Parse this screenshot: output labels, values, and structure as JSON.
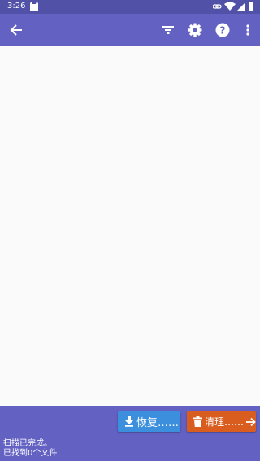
{
  "status_bar": {
    "time": "3:26"
  },
  "toolbar": {
    "back_icon": "arrow-left-icon",
    "filter_icon": "filter-icon",
    "settings_icon": "gear-icon",
    "help_icon": "help-icon",
    "more_icon": "more-vert-icon"
  },
  "actions": {
    "recover_label": "恢复……",
    "clean_label": "清理……"
  },
  "status": {
    "line1": "扫描已完成。",
    "line2": "已找到0个文件"
  },
  "colors": {
    "status_bar": "#5151a8",
    "toolbar": "#6361c2",
    "recover_button": "#3b8fdc",
    "clean_button": "#d95d1f",
    "content_bg": "#fafafa"
  }
}
